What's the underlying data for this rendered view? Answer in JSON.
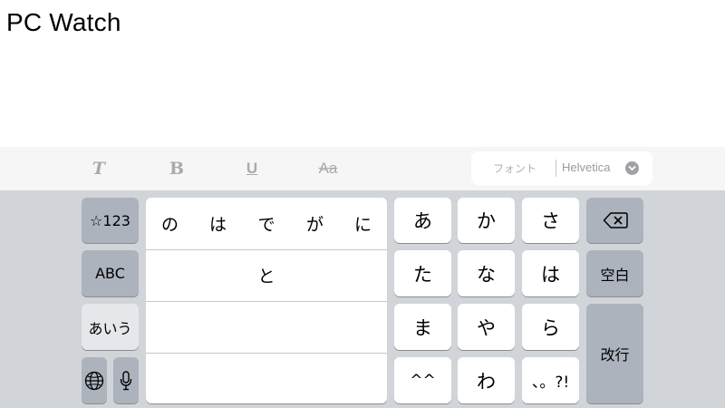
{
  "document": {
    "title": "PC Watch"
  },
  "format_bar": {
    "italic": "T",
    "bold": "B",
    "underline": "U",
    "strikethrough": "Aa",
    "font_label": "フォント",
    "font_value": "Helvetica"
  },
  "keyboard": {
    "left": {
      "numbers": "☆123",
      "abc": "ABC",
      "kana": "あいう"
    },
    "candidates": {
      "row1": [
        "の",
        "は",
        "で",
        "が",
        "に"
      ],
      "row2": [
        "と"
      ]
    },
    "kana_keys": [
      "あ",
      "か",
      "さ",
      "た",
      "な",
      "は",
      "ま",
      "や",
      "ら",
      "^^",
      "わ",
      "、。?!"
    ],
    "right": {
      "space": "空白",
      "enter": "改行"
    }
  }
}
